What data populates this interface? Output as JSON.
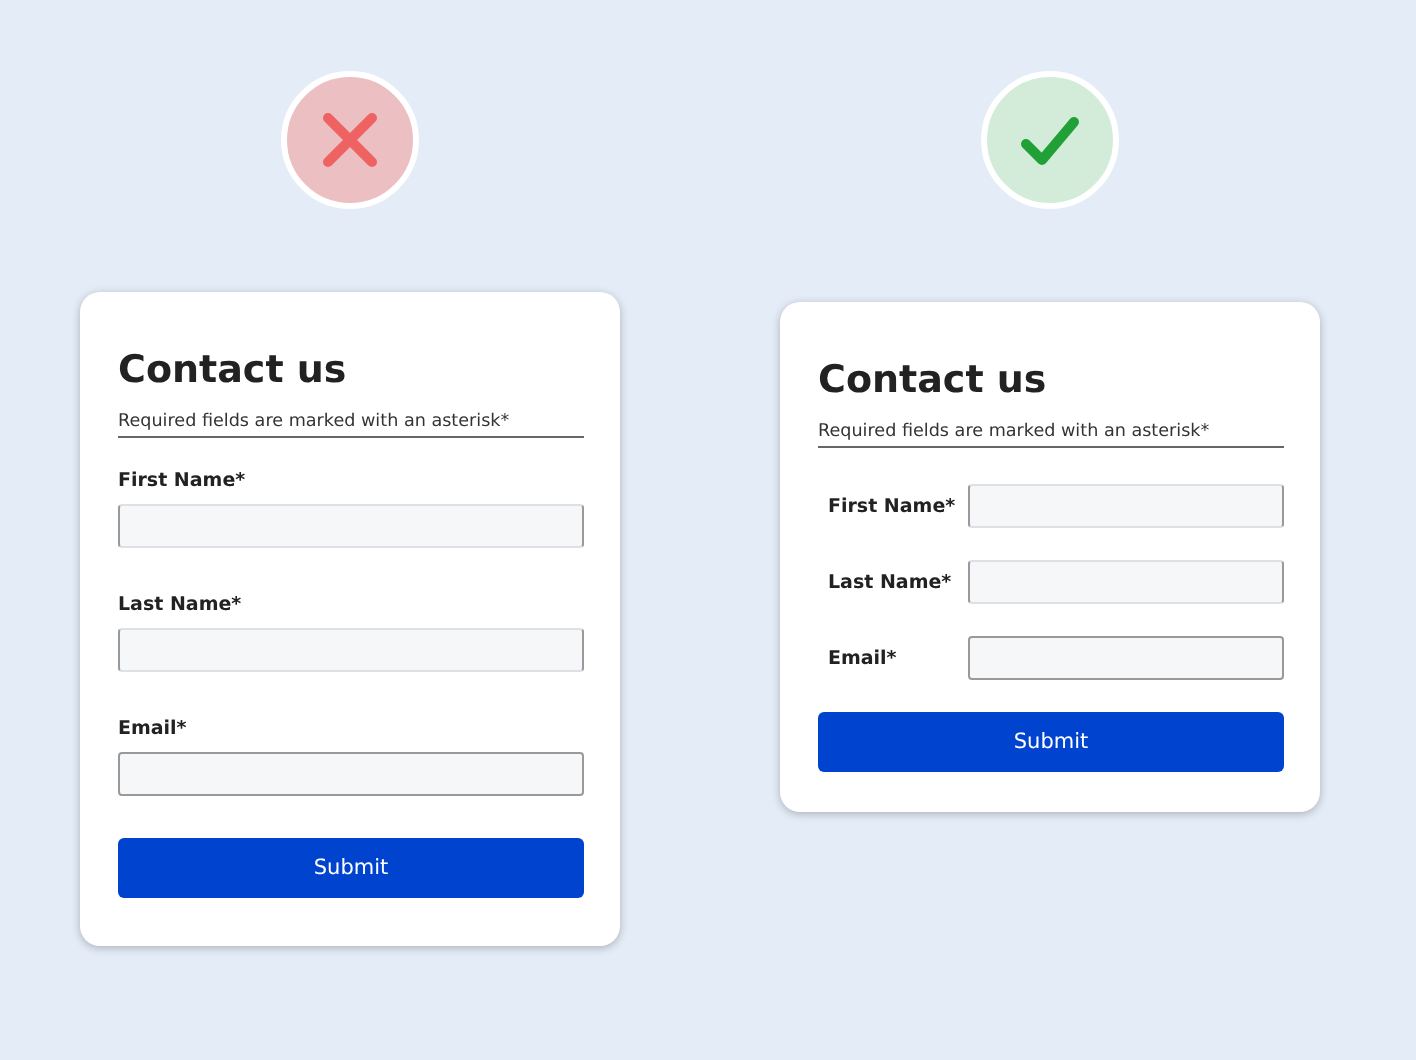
{
  "examples": [
    {
      "badge": {
        "kind": "cross"
      },
      "form": {
        "kind": "stacked",
        "title": "Contact us",
        "note": "Required fields are marked with an asterisk*",
        "fields": [
          {
            "label": "First Name*"
          },
          {
            "label": "Last Name*"
          },
          {
            "label": "Email*"
          }
        ],
        "button": "Submit"
      }
    },
    {
      "badge": {
        "kind": "check"
      },
      "form": {
        "kind": "inline",
        "title": "Contact us",
        "note": "Required fields are marked with an asterisk*",
        "fields": [
          {
            "label": "First Name*"
          },
          {
            "label": "Last Name*"
          },
          {
            "label": "Email*"
          }
        ],
        "button": "Submit"
      }
    }
  ]
}
